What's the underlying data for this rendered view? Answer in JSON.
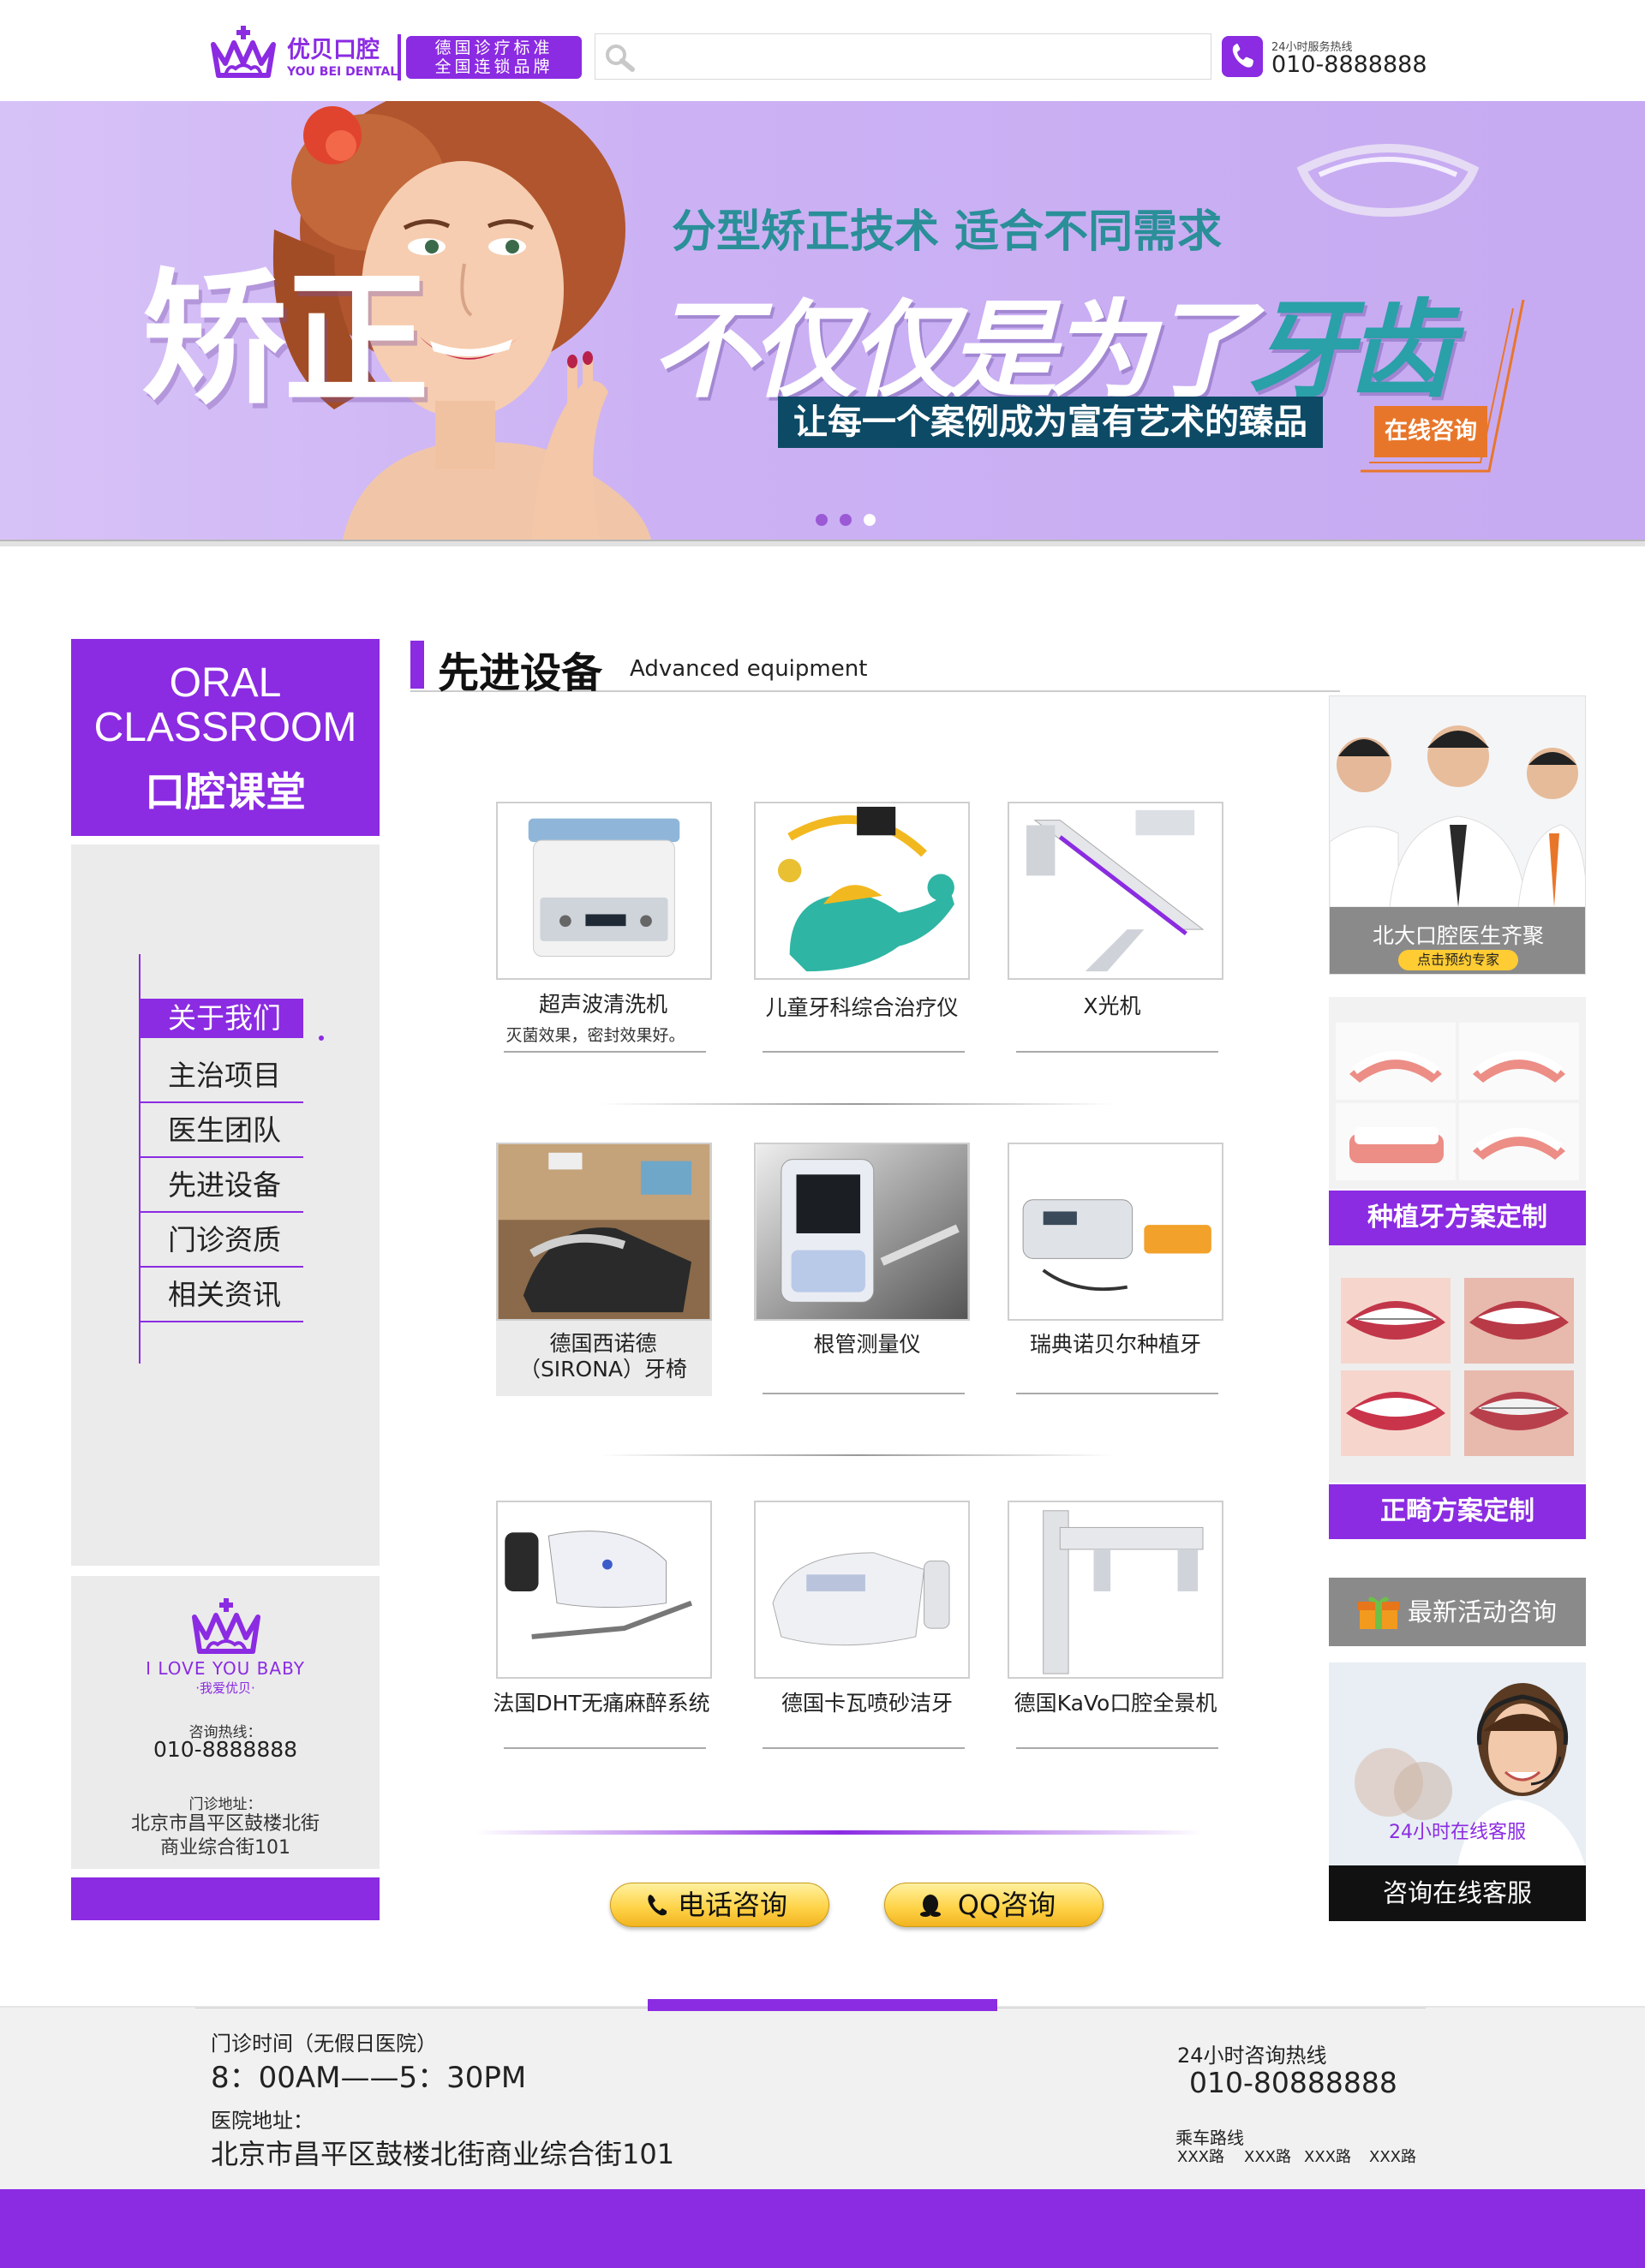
{
  "header": {
    "logo_cn": "优贝口腔",
    "logo_en": "YOU BEI DENTAL",
    "slogan_line1": "德国诊疗标准",
    "slogan_line2": "全国连锁品牌",
    "search_placeholder": "",
    "hotline_label": "24小时服务热线",
    "hotline_number": "010-8888888"
  },
  "banner": {
    "main_word": "矫正",
    "subtitle": "分型矫正技术  适合不同需求",
    "headline_part1": "不仅仅是为了",
    "headline_part2": "牙齿",
    "tagline": "让每一个案例成为富有艺术的臻品",
    "cta": "在线咨询",
    "dots": 3,
    "active_dot": 1
  },
  "sidebar": {
    "classroom_en_line1": "ORAL",
    "classroom_en_line2": "CLASSROOM",
    "classroom_cn": "口腔课堂",
    "menu": [
      {
        "label": "关于我们",
        "active": true
      },
      {
        "label": "主治项目",
        "active": false
      },
      {
        "label": "医生团队",
        "active": false
      },
      {
        "label": "先进设备",
        "active": false
      },
      {
        "label": "门诊资质",
        "active": false
      },
      {
        "label": "相关资讯",
        "active": false
      }
    ],
    "contact": {
      "love": "I LOVE YOU BABY",
      "love_cn": "·我爱优贝·",
      "hotline_label": "咨询热线：",
      "hotline": "010-8888888",
      "address_label": "门诊地址：",
      "address_line1": "北京市昌平区鼓楼北街",
      "address_line2": "商业综合街101"
    }
  },
  "main": {
    "section_title_cn": "先进设备",
    "section_title_en": "Advanced equipment",
    "equipment": [
      {
        "name": "超声波清洗机",
        "desc": "灭菌效果，密封效果好。"
      },
      {
        "name": "儿童牙科综合治疗仪"
      },
      {
        "name": "X光机"
      },
      {
        "name_line1": "德国西诺德",
        "name_line2": "（SIRONA）牙椅"
      },
      {
        "name": "根管测量仪"
      },
      {
        "name": "瑞典诺贝尔种植牙"
      },
      {
        "name": "法国DHT无痛麻醉系统"
      },
      {
        "name": "德国卡瓦喷砂洁牙"
      },
      {
        "name": "德国KaVo口腔全景机"
      }
    ],
    "buttons": {
      "phone": "电话咨询",
      "qq": "QQ咨询"
    }
  },
  "right": {
    "doctors_title": "北大口腔医生齐聚",
    "doctors_btn": "点击预约专家",
    "implant_label": "种植牙方案定制",
    "ortho_label": "正畸方案定制",
    "activity_label": "最新活动咨询",
    "support_text": "24小时在线客服",
    "support_label": "咨询在线客服"
  },
  "footer": {
    "hours_label": "门诊时间（无假日医院）",
    "hours": "8：00AM——5：30PM",
    "address_label": "医院地址：",
    "address": "北京市昌平区鼓楼北街商业综合街101",
    "hotline_label": "24小时咨询热线",
    "hotline": "010-80888888",
    "route_label": "乘车路线",
    "routes": [
      "XXX路",
      "XXX路",
      "XXX路",
      "XXX路"
    ]
  },
  "colors": {
    "brand_purple": "#8b2be2",
    "banner_teal": "#2aa0a8",
    "cta_orange": "#e8762a",
    "button_yellow": "#ffd44a"
  }
}
